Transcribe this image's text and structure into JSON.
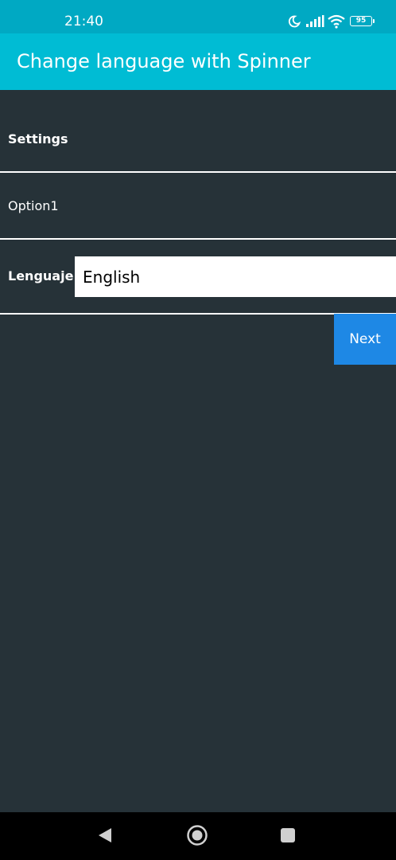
{
  "status_bar": {
    "time": "21:40",
    "battery_level": "95",
    "icons": [
      "moon-icon",
      "signal-icon",
      "wifi-icon",
      "battery-icon"
    ]
  },
  "app_bar": {
    "title": "Change language with Spinner"
  },
  "settings": {
    "header": "Settings",
    "option1": "Option1",
    "language_label": "Lenguaje",
    "language_selected": "English"
  },
  "actions": {
    "next_label": "Next"
  },
  "nav_bar": {
    "icons": [
      "back-icon",
      "home-icon",
      "recents-icon"
    ]
  },
  "colors": {
    "status_bar": "#00a9c3",
    "app_bar": "#00bcd4",
    "background": "#263238",
    "next_button": "#1e88e5",
    "nav_bar": "#000000"
  }
}
